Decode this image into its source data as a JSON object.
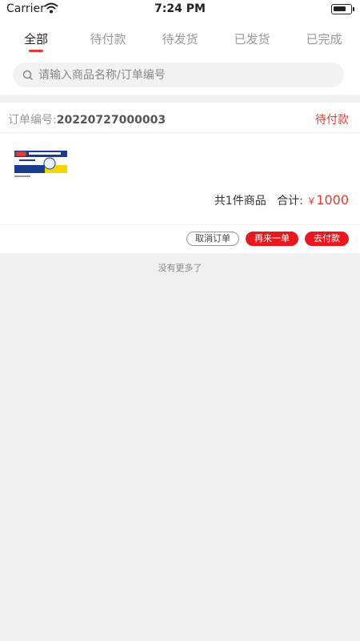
{
  "status_bar": {
    "carrier": "Carrier",
    "time": "7:24 PM"
  },
  "tabs": [
    {
      "label": "全部",
      "active": true
    },
    {
      "label": "待付款",
      "active": false
    },
    {
      "label": "待发货",
      "active": false
    },
    {
      "label": "已发货",
      "active": false
    },
    {
      "label": "已完成",
      "active": false
    }
  ],
  "search": {
    "placeholder": "请输入商品名称/订单编号"
  },
  "order": {
    "number_label": "订单编号:",
    "number": "20220727000003",
    "status": "待付款",
    "summary_count": "共1件商品",
    "summary_total_label": "合计:",
    "currency": "￥",
    "total": "1000",
    "actions": {
      "cancel": "取消订单",
      "reorder": "再来一单",
      "pay": "去付款"
    }
  },
  "footer": {
    "no_more": "没有更多了"
  },
  "colors": {
    "accent": "#e23a2e",
    "button_red": "#e8191e"
  }
}
